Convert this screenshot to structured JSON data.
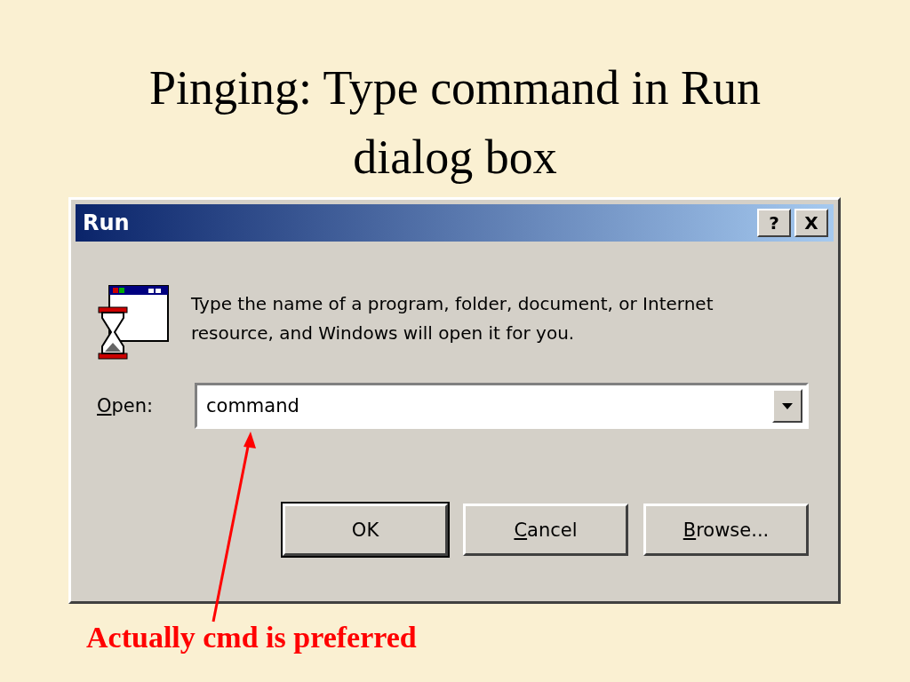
{
  "slide": {
    "title": "Pinging:  Type command in Run dialog box",
    "note": "Actually cmd is preferred"
  },
  "dialog": {
    "title": "Run",
    "title_buttons": [
      "?",
      "X"
    ],
    "message": "Type the name of a program, folder, document, or Internet resource, and Windows will open it for you.",
    "open_label": "Open:",
    "open_value": "command",
    "buttons": [
      {
        "label": "OK",
        "default": true
      },
      {
        "label": "Cancel",
        "default": false
      },
      {
        "label": "Browse...",
        "default": false
      }
    ]
  }
}
